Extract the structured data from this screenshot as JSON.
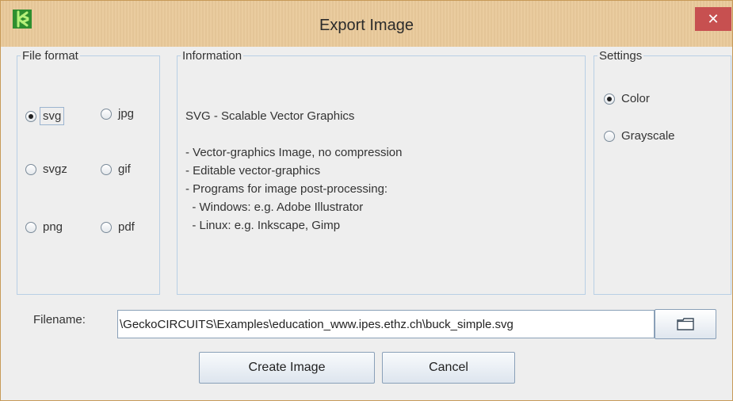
{
  "window": {
    "title": "Export Image",
    "close_label": "✕",
    "accent": "#c75050",
    "title_bg": "#e9c99a"
  },
  "file_format": {
    "legend": "File format",
    "options": [
      "svg",
      "jpg",
      "svgz",
      "gif",
      "png",
      "pdf"
    ],
    "selected": "svg"
  },
  "information": {
    "legend": "Information",
    "heading": "SVG - Scalable Vector Graphics",
    "lines": [
      "- Vector-graphics Image, no compression",
      "- Editable vector-graphics",
      "- Programs for image post-processing:",
      "  - Windows: e.g. Adobe Illustrator",
      "  - Linux: e.g. Inkscape, Gimp"
    ]
  },
  "settings": {
    "legend": "Settings",
    "options": [
      "Color",
      "Grayscale"
    ],
    "selected": "Color"
  },
  "filename": {
    "label": "Filename:",
    "value": "\\GeckoCIRCUITS\\Examples\\education_www.ipes.ethz.ch\\buck_simple.svg",
    "browse_icon": "folder-icon"
  },
  "buttons": {
    "create": "Create Image",
    "cancel": "Cancel"
  }
}
